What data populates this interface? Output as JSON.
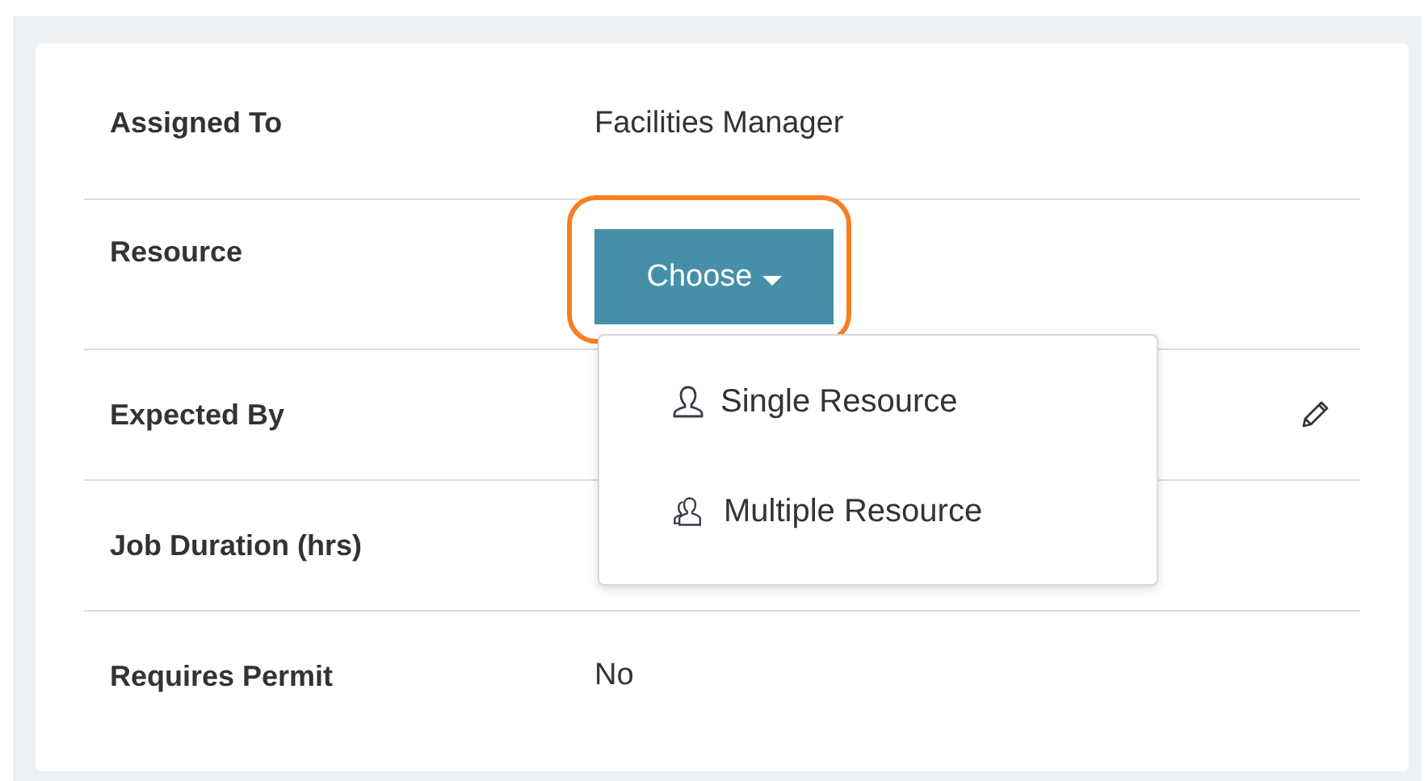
{
  "fields": [
    {
      "kind": "text",
      "label": "Assigned To",
      "value": "Facilities Manager"
    },
    {
      "kind": "dropdown",
      "label": "Resource",
      "button": "Choose",
      "highlighted": true,
      "expanded": true,
      "menu": [
        {
          "label": "Single Resource",
          "kind": "single"
        },
        {
          "label": "Multiple Resource",
          "kind": "multiple"
        }
      ]
    },
    {
      "kind": "text",
      "label": "Expected By",
      "editable": true
    },
    {
      "kind": "text",
      "label": "Job Duration (hrs)"
    },
    {
      "kind": "text",
      "label": "Requires Permit",
      "value": "No"
    }
  ]
}
